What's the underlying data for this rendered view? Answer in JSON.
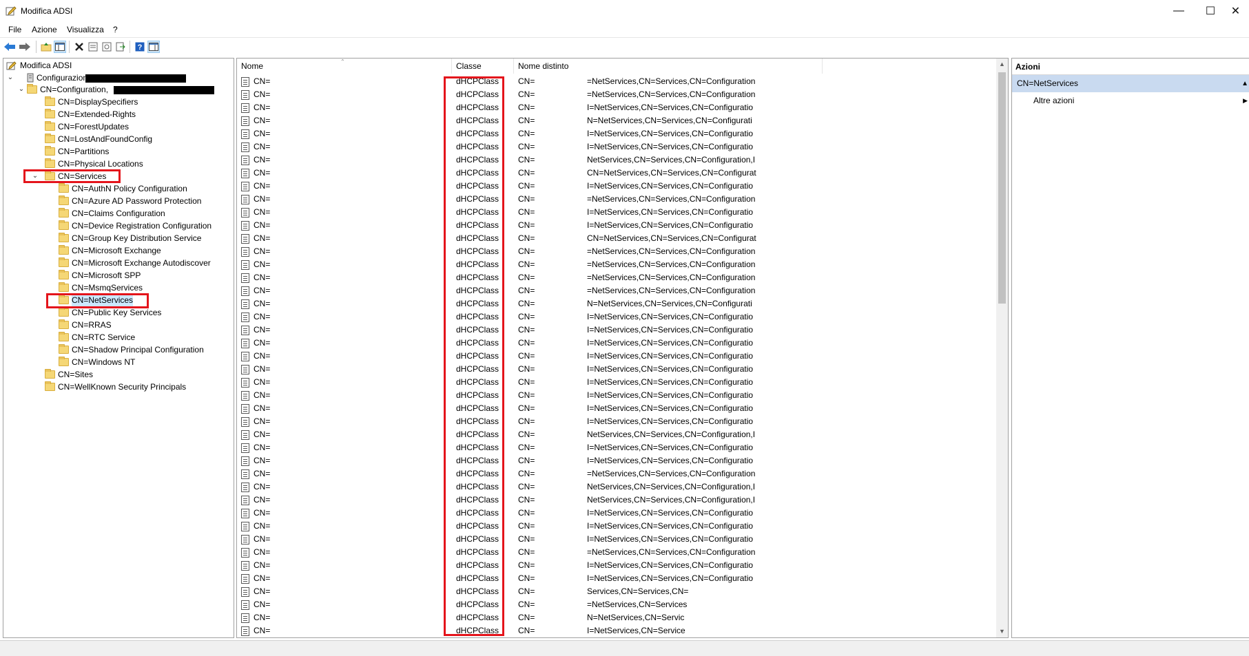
{
  "window": {
    "title": "Modifica ADSI",
    "controls": {
      "minimize": "—",
      "maximize": "☐",
      "close": "✕"
    }
  },
  "menu": [
    "File",
    "Azione",
    "Visualizza",
    "?"
  ],
  "toolbar": {
    "icons": [
      "back-icon",
      "forward-icon",
      "up-folder-icon",
      "show-tree-icon",
      "delete-icon",
      "properties-icon",
      "refresh-icon",
      "export-icon",
      "help-icon",
      "show-action-pane-icon"
    ]
  },
  "tree": {
    "root": "Modifica ADSI",
    "nodes": [
      "Configurazione [",
      "CN=Configuration,",
      "CN=DisplaySpecifiers",
      "CN=Extended-Rights",
      "CN=ForestUpdates",
      "CN=LostAndFoundConfig",
      "CN=Partitions",
      "CN=Physical Locations",
      "CN=Services",
      "CN=AuthN Policy Configuration",
      "CN=Azure AD Password Protection",
      "CN=Claims Configuration",
      "CN=Device Registration Configuration",
      "CN=Group Key Distribution Service",
      "CN=Microsoft Exchange",
      "CN=Microsoft Exchange Autodiscover",
      "CN=Microsoft SPP",
      "CN=MsmqServices",
      "CN=NetServices",
      "CN=Public Key Services",
      "CN=RRAS",
      "CN=RTC Service",
      "CN=Shadow Principal Configuration",
      "CN=Windows NT",
      "CN=Sites",
      "CN=WellKnown Security Principals"
    ]
  },
  "list": {
    "columns": [
      "Nome",
      "Classe",
      "Nome distinto"
    ],
    "rows": [
      {
        "name": "CN=",
        "class": "dHCPClass",
        "dn_prefix": "CN=",
        "dn_tail": "=NetServices,CN=Services,CN=Configuration"
      },
      {
        "name": "CN=",
        "class": "dHCPClass",
        "dn_prefix": "CN=",
        "dn_tail": "=NetServices,CN=Services,CN=Configuration"
      },
      {
        "name": "CN=",
        "class": "dHCPClass",
        "dn_prefix": "CN=",
        "dn_tail": "I=NetServices,CN=Services,CN=Configuratio"
      },
      {
        "name": "CN=",
        "class": "dHCPClass",
        "dn_prefix": "CN=",
        "dn_tail": "N=NetServices,CN=Services,CN=Configurati"
      },
      {
        "name": "CN=",
        "class": "dHCPClass",
        "dn_prefix": "CN=",
        "dn_tail": "I=NetServices,CN=Services,CN=Configuratio"
      },
      {
        "name": "CN=",
        "class": "dHCPClass",
        "dn_prefix": "CN=",
        "dn_tail": "I=NetServices,CN=Services,CN=Configuratio"
      },
      {
        "name": "CN=",
        "class": "dHCPClass",
        "dn_prefix": "CN=",
        "dn_tail": "NetServices,CN=Services,CN=Configuration,I"
      },
      {
        "name": "CN=",
        "class": "dHCPClass",
        "dn_prefix": "CN=",
        "dn_tail": "CN=NetServices,CN=Services,CN=Configurat"
      },
      {
        "name": "CN=",
        "class": "dHCPClass",
        "dn_prefix": "CN=",
        "dn_tail": "I=NetServices,CN=Services,CN=Configuratio"
      },
      {
        "name": "CN=",
        "class": "dHCPClass",
        "dn_prefix": "CN=",
        "dn_tail": "=NetServices,CN=Services,CN=Configuration"
      },
      {
        "name": "CN=",
        "class": "dHCPClass",
        "dn_prefix": "CN=",
        "dn_tail": "I=NetServices,CN=Services,CN=Configuratio"
      },
      {
        "name": "CN=",
        "class": "dHCPClass",
        "dn_prefix": "CN=",
        "dn_tail": "I=NetServices,CN=Services,CN=Configuratio"
      },
      {
        "name": "CN=",
        "class": "dHCPClass",
        "dn_prefix": "CN=",
        "dn_tail": "CN=NetServices,CN=Services,CN=Configurat"
      },
      {
        "name": "CN=",
        "class": "dHCPClass",
        "dn_prefix": "CN=",
        "dn_tail": "=NetServices,CN=Services,CN=Configuration"
      },
      {
        "name": "CN=",
        "class": "dHCPClass",
        "dn_prefix": "CN=",
        "dn_tail": "=NetServices,CN=Services,CN=Configuration"
      },
      {
        "name": "CN=",
        "class": "dHCPClass",
        "dn_prefix": "CN=",
        "dn_tail": "=NetServices,CN=Services,CN=Configuration"
      },
      {
        "name": "CN=",
        "class": "dHCPClass",
        "dn_prefix": "CN=",
        "dn_tail": "=NetServices,CN=Services,CN=Configuration"
      },
      {
        "name": "CN=",
        "class": "dHCPClass",
        "dn_prefix": "CN=",
        "dn_tail": "N=NetServices,CN=Services,CN=Configurati"
      },
      {
        "name": "CN=",
        "class": "dHCPClass",
        "dn_prefix": "CN=",
        "dn_tail": "I=NetServices,CN=Services,CN=Configuratio"
      },
      {
        "name": "CN=",
        "class": "dHCPClass",
        "dn_prefix": "CN=",
        "dn_tail": "I=NetServices,CN=Services,CN=Configuratio"
      },
      {
        "name": "CN=",
        "class": "dHCPClass",
        "dn_prefix": "CN=",
        "dn_tail": "I=NetServices,CN=Services,CN=Configuratio"
      },
      {
        "name": "CN=",
        "class": "dHCPClass",
        "dn_prefix": "CN=",
        "dn_tail": "I=NetServices,CN=Services,CN=Configuratio"
      },
      {
        "name": "CN=",
        "class": "dHCPClass",
        "dn_prefix": "CN=",
        "dn_tail": "I=NetServices,CN=Services,CN=Configuratio"
      },
      {
        "name": "CN=",
        "class": "dHCPClass",
        "dn_prefix": "CN=",
        "dn_tail": "I=NetServices,CN=Services,CN=Configuratio"
      },
      {
        "name": "CN=",
        "class": "dHCPClass",
        "dn_prefix": "CN=",
        "dn_tail": "I=NetServices,CN=Services,CN=Configuratio"
      },
      {
        "name": "CN=",
        "class": "dHCPClass",
        "dn_prefix": "CN=",
        "dn_tail": "I=NetServices,CN=Services,CN=Configuratio"
      },
      {
        "name": "CN=",
        "class": "dHCPClass",
        "dn_prefix": "CN=",
        "dn_tail": "I=NetServices,CN=Services,CN=Configuratio"
      },
      {
        "name": "CN=",
        "class": "dHCPClass",
        "dn_prefix": "CN=",
        "dn_tail": "NetServices,CN=Services,CN=Configuration,I"
      },
      {
        "name": "CN=",
        "class": "dHCPClass",
        "dn_prefix": "CN=",
        "dn_tail": "I=NetServices,CN=Services,CN=Configuratio"
      },
      {
        "name": "CN=",
        "class": "dHCPClass",
        "dn_prefix": "CN=",
        "dn_tail": "I=NetServices,CN=Services,CN=Configuratio"
      },
      {
        "name": "CN=",
        "class": "dHCPClass",
        "dn_prefix": "CN=",
        "dn_tail": "=NetServices,CN=Services,CN=Configuration"
      },
      {
        "name": "CN=",
        "class": "dHCPClass",
        "dn_prefix": "CN=",
        "dn_tail": "NetServices,CN=Services,CN=Configuration,I"
      },
      {
        "name": "CN=",
        "class": "dHCPClass",
        "dn_prefix": "CN=",
        "dn_tail": "NetServices,CN=Services,CN=Configuration,I"
      },
      {
        "name": "CN=",
        "class": "dHCPClass",
        "dn_prefix": "CN=",
        "dn_tail": "I=NetServices,CN=Services,CN=Configuratio"
      },
      {
        "name": "CN=",
        "class": "dHCPClass",
        "dn_prefix": "CN=",
        "dn_tail": "I=NetServices,CN=Services,CN=Configuratio"
      },
      {
        "name": "CN=",
        "class": "dHCPClass",
        "dn_prefix": "CN=",
        "dn_tail": "I=NetServices,CN=Services,CN=Configuratio"
      },
      {
        "name": "CN=",
        "class": "dHCPClass",
        "dn_prefix": "CN=",
        "dn_tail": "=NetServices,CN=Services,CN=Configuration"
      },
      {
        "name": "CN=",
        "class": "dHCPClass",
        "dn_prefix": "CN=",
        "dn_tail": "I=NetServices,CN=Services,CN=Configuratio"
      },
      {
        "name": "CN=",
        "class": "dHCPClass",
        "dn_prefix": "CN=",
        "dn_tail": "I=NetServices,CN=Services,CN=Configuratio"
      },
      {
        "name": "CN=",
        "class": "dHCPClass",
        "dn_prefix": "CN=",
        "dn_tail": "Services,CN=Services,CN="
      },
      {
        "name": "CN=",
        "class": "dHCPClass",
        "dn_prefix": "CN=",
        "dn_tail": "=NetServices,CN=Services"
      },
      {
        "name": "CN=",
        "class": "dHCPClass",
        "dn_prefix": "CN=",
        "dn_tail": "N=NetServices,CN=Servic"
      },
      {
        "name": "CN=",
        "class": "dHCPClass",
        "dn_prefix": "CN=",
        "dn_tail": "I=NetServices,CN=Service"
      }
    ]
  },
  "actions": {
    "header": "Azioni",
    "section": "CN=NetServices",
    "items": [
      "Altre azioni"
    ]
  },
  "colors": {
    "highlight_box": "#e4141b",
    "actions_section_bg": "#c9daf0",
    "selected_node_bg": "#cce8ff"
  }
}
